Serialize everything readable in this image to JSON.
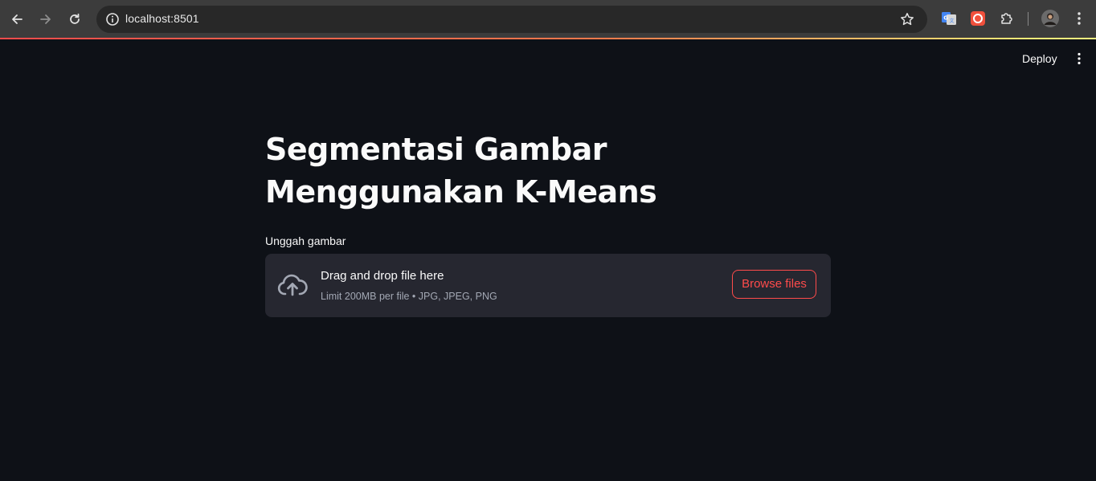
{
  "browser": {
    "url": "localhost:8501",
    "icons": {
      "back": "back-arrow-icon",
      "forward": "forward-arrow-icon",
      "reload": "reload-icon",
      "site_info": "info-icon",
      "bookmark": "star-icon",
      "translate_extension": "google-translate-icon",
      "red_extension": "record-extension-icon",
      "extensions": "puzzle-icon",
      "profile": "avatar",
      "menu": "kebab-menu-icon"
    },
    "accent_gradient": [
      "#ff4b4b",
      "#fffd80"
    ]
  },
  "header": {
    "deploy_label": "Deploy",
    "menu_icon": "kebab-menu-icon"
  },
  "main": {
    "title": "Segmentasi Gambar Menggunakan K-Means",
    "uploader": {
      "label": "Unggah gambar",
      "drop_text": "Drag and drop file here",
      "limit_text": "Limit 200MB per file • JPG, JPEG, PNG",
      "button_label": "Browse files",
      "icon": "cloud-upload-icon"
    }
  },
  "colors": {
    "background": "#0e1117",
    "dropzone": "#262730",
    "accent": "#ff4b4b",
    "text": "#fafafa",
    "muted_text": "#a3a8b4"
  }
}
